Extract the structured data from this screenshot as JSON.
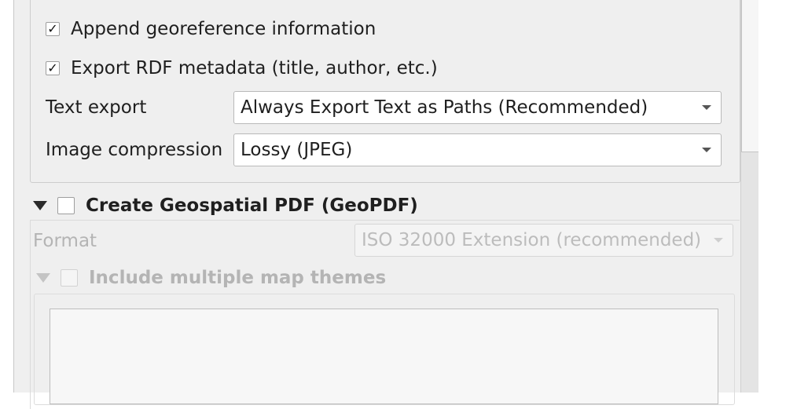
{
  "pdf_options": {
    "append_georeference": {
      "label": "Append georeference information",
      "checked": true
    },
    "export_rdf_metadata": {
      "label": "Export RDF metadata (title, author, etc.)",
      "checked": true
    },
    "text_export": {
      "label": "Text export",
      "value": "Always Export Text as Paths (Recommended)"
    },
    "image_compression": {
      "label": "Image compression",
      "value": "Lossy (JPEG)"
    }
  },
  "geopdf": {
    "title": "Create Geospatial PDF (GeoPDF)",
    "checked": false,
    "format_label": "Format",
    "format_value": "ISO 32000 Extension (recommended)",
    "map_themes": {
      "label": "Include multiple map themes",
      "checked": false
    }
  },
  "icons": {
    "check": "checkmark-icon",
    "collapse": "triangle-down-icon",
    "dropdown": "chevron-down-icon"
  }
}
